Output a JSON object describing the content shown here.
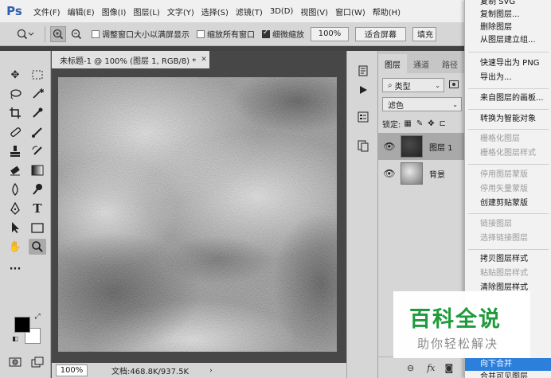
{
  "app": {
    "logo": "Ps"
  },
  "menubar": {
    "items": [
      "文件(F)",
      "编辑(E)",
      "图像(I)",
      "图层(L)",
      "文字(Y)",
      "选择(S)",
      "滤镜(T)",
      "3D(D)",
      "视图(V)",
      "窗口(W)",
      "帮助(H)"
    ]
  },
  "options_bar": {
    "resize_windows": "调整窗口大小以满屏显示",
    "zoom_all": "缩放所有窗口",
    "scrubby_zoom": "细微缩放",
    "zoom_value": "100%",
    "fit_screen": "适合屏幕",
    "fill_screen": "填充"
  },
  "document": {
    "tab_title": "未标题-1 @ 100% (图层 1, RGB/8) *",
    "zoom": "100%",
    "doc_size": "文档:468.8K/937.5K"
  },
  "layers_panel": {
    "tabs": [
      "图层",
      "通道",
      "路径"
    ],
    "filter_type": "类型",
    "blend_mode": "滤色",
    "lock_label": "锁定:",
    "layers": [
      {
        "name": "图层 1",
        "selected": true
      },
      {
        "name": "背景",
        "selected": false
      }
    ]
  },
  "context_menu": {
    "items": [
      {
        "label": "复制 SVG",
        "disabled": false
      },
      {
        "label": "复制图层...",
        "disabled": false
      },
      {
        "label": "删除图层",
        "disabled": false
      },
      {
        "label": "从图层建立组...",
        "disabled": false
      },
      {
        "label": "快速导出为 PNG",
        "disabled": false
      },
      {
        "label": "导出为...",
        "disabled": false
      },
      {
        "label": "来自图层的画板...",
        "disabled": false
      },
      {
        "label": "转换为智能对象",
        "disabled": false
      },
      {
        "label": "栅格化图层",
        "disabled": true
      },
      {
        "label": "栅格化图层样式",
        "disabled": true
      },
      {
        "label": "停用图层蒙版",
        "disabled": true
      },
      {
        "label": "停用矢量蒙版",
        "disabled": true
      },
      {
        "label": "创建剪贴蒙版",
        "disabled": false
      },
      {
        "label": "链接图层",
        "disabled": true
      },
      {
        "label": "选择链接图层",
        "disabled": true
      },
      {
        "label": "拷贝图层样式",
        "disabled": false
      },
      {
        "label": "粘贴图层样式",
        "disabled": true
      },
      {
        "label": "清除图层样式",
        "disabled": false
      },
      {
        "label": "向下合并",
        "disabled": false,
        "highlighted": true
      },
      {
        "label": "合并可见图层",
        "disabled": false
      }
    ]
  },
  "watermark": {
    "title": "百科全说",
    "subtitle": "助你轻松解决"
  },
  "colors": {
    "menu_highlight": "#2d7fdc",
    "brand_green": "#1e9b3a",
    "ps_blue": "#2e5fb5"
  }
}
